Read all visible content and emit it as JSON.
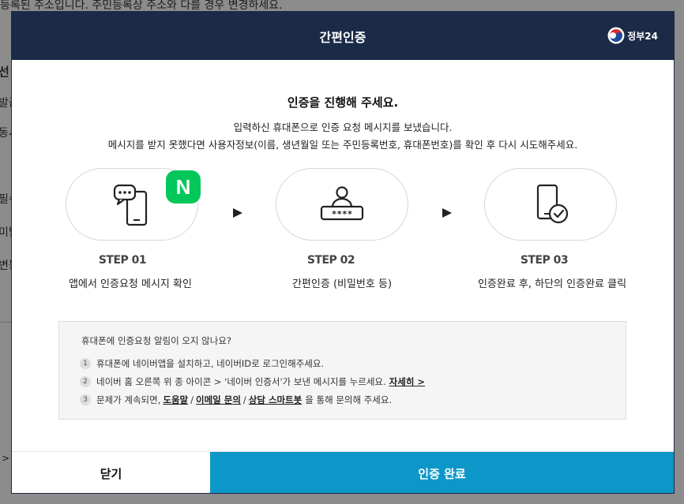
{
  "background": {
    "top_notice": "등록된 주소입니다. 주민등록상 주소와 다를 경우 변경하세요.",
    "left_fragments": [
      "선",
      "발급",
      "동시",
      "필수",
      "미발",
      "변동",
      ">"
    ]
  },
  "modal": {
    "title": "간편인증",
    "logo_text": "정부24",
    "headline": "인증을 진행해 주세요.",
    "description_line1": "입력하신 휴대폰으로 인증 요청 메시지를 보냈습니다.",
    "description_line2": "메시지를 받지 못했다면 사용자정보(이름, 생년월일 또는 주민등록번호, 휴대폰번호)를 확인 후 다시 시도해주세요.",
    "naver_badge": "N",
    "steps": [
      {
        "number": "STEP 01",
        "label": "앱에서 인증요청 메시지 확인",
        "icon": "phone-message-icon"
      },
      {
        "number": "STEP 02",
        "label": "간편인증 (비밀번호 등)",
        "icon": "password-user-icon"
      },
      {
        "number": "STEP 03",
        "label": "인증완료 후, 하단의 인증완료 클릭",
        "icon": "phone-check-icon"
      }
    ],
    "help": {
      "title": "휴대폰에 인증요청 알림이 오지 않나요?",
      "items": [
        {
          "num": "1",
          "text": "휴대폰에 네이버앱을 설치하고, 네이버ID로 로그인해주세요."
        },
        {
          "num": "2",
          "text": "네이버 홈 오른쪽 위 종 아이콘 > '네이버 인증서'가 보낸 메시지를 누르세요.",
          "link": "자세히 >"
        },
        {
          "num": "3",
          "text_prefix": "문제가 계속되면,",
          "links": [
            "도움말",
            "이메일 문의",
            "상담 스마트봇"
          ],
          "separator": "/",
          "text_suffix": "을 통해 문의해 주세요."
        }
      ]
    },
    "buttons": {
      "close": "닫기",
      "confirm": "인증 완료"
    }
  },
  "colors": {
    "header_bg": "#1b2a47",
    "confirm_bg": "#0d97c8",
    "naver_green": "#03c75a"
  }
}
